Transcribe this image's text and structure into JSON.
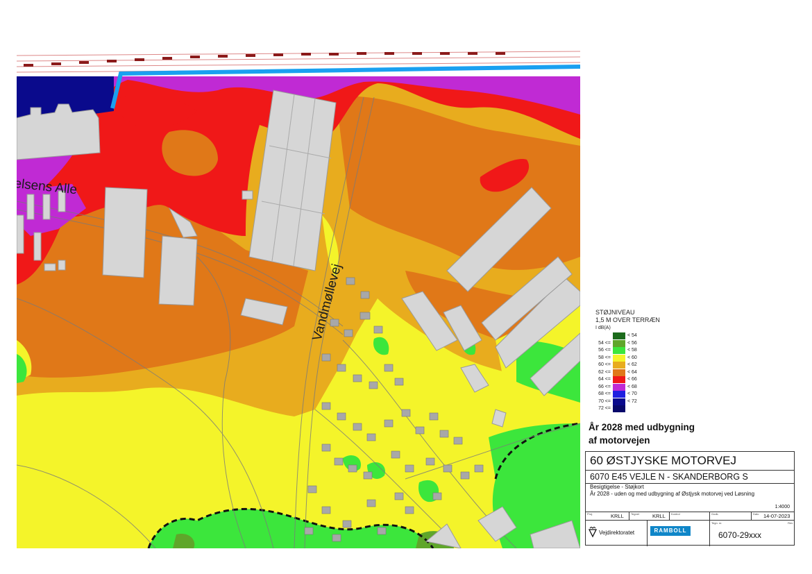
{
  "map": {
    "road_label_1": "elsens Alle",
    "road_label_2": "Vandmøllevej"
  },
  "legend": {
    "title": "STØJNIVEAU",
    "subtitle": "1,5 M OVER TERRÆN",
    "unit": "I dB(A)",
    "items": [
      {
        "lo": "",
        "hi": "< 54",
        "color": "#1c6b1c"
      },
      {
        "lo": "54 <=",
        "hi": "< 56",
        "color": "#5fa62a"
      },
      {
        "lo": "56 <=",
        "hi": "< 58",
        "color": "#3ce63c"
      },
      {
        "lo": "58 <=",
        "hi": "< 60",
        "color": "#f4f42a"
      },
      {
        "lo": "60 <=",
        "hi": "< 62",
        "color": "#e8ac1e"
      },
      {
        "lo": "62 <=",
        "hi": "< 64",
        "color": "#e07818"
      },
      {
        "lo": "64 <=",
        "hi": "< 66",
        "color": "#f01818"
      },
      {
        "lo": "66 <=",
        "hi": "< 68",
        "color": "#c02ad4"
      },
      {
        "lo": "68 <=",
        "hi": "< 70",
        "color": "#2020e0"
      },
      {
        "lo": "70 <=",
        "hi": "< 72",
        "color": "#0a0a8c"
      },
      {
        "lo": "72 <=",
        "hi": "",
        "color": "#08086a"
      }
    ]
  },
  "caption": {
    "line1": "År 2028 med udbygning",
    "line2": "af motorvejen"
  },
  "titleblock": {
    "project": "60 ØSTJYSKE MOTORVEJ",
    "section": "6070 E45 VEJLE N - SKANDERBORG S",
    "desc1": "Besigtigelse - Støjkort",
    "desc2": "År 2028 - uden og med udbygning af Østjysk motorvej ved Løsning",
    "scale": "1:4000",
    "proj_label": "Proj.",
    "proj": "KRLL",
    "tegnet_label": "Tegnet",
    "tegnet": "KRLL",
    "kontrol_label": "Kontrol",
    "godk_label": "Godk.",
    "dato_label": "Dato",
    "date": "14-07-2023",
    "owner": "Vejdirektoratet",
    "consultant": "RAMBOLL",
    "tegn_label": "Tegn. nr.",
    "rev_label": "Rev.",
    "drawing_no": "6070-29xxx"
  }
}
